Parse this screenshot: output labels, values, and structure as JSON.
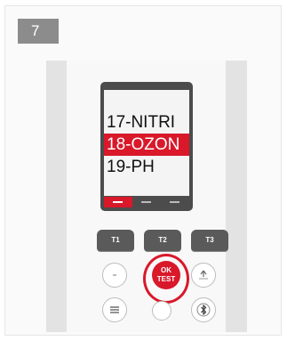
{
  "step": {
    "number": "7"
  },
  "display": {
    "menu_items": [
      {
        "label": "17-NITRI",
        "selected": false
      },
      {
        "label": "18-OZON",
        "selected": true
      },
      {
        "label": "19-PH",
        "selected": false
      }
    ]
  },
  "keys": {
    "t1": "T1",
    "t2": "T2",
    "t3": "T3",
    "ok_line1": "OK",
    "ok_line2": "TEST"
  },
  "icons": {
    "minus": "minus-icon",
    "up_arrow": "up-arrow-icon",
    "menu": "menu-lines-icon",
    "bluetooth": "bluetooth-icon"
  },
  "colors": {
    "accent": "#d9182a",
    "device_frame": "#4c4c4c"
  }
}
